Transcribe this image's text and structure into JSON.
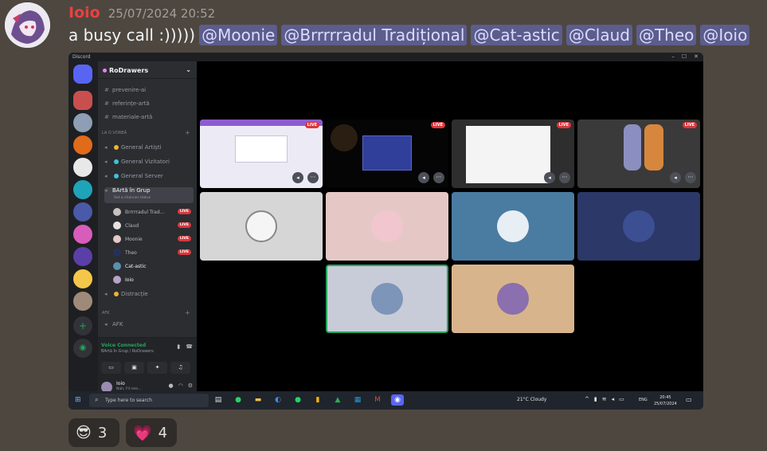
{
  "message": {
    "author": "Ioio",
    "timestamp": "25/07/2024 20:52",
    "text": "a busy call :)))))",
    "mentions": [
      "@Moonie",
      "@Brrrrradul Tradițional",
      "@Cat-astic",
      "@Claud",
      "@Theo",
      "@Ioio"
    ],
    "author_color": "#e8423f"
  },
  "screenshot": {
    "titlebar": {
      "app": "Discord",
      "min": "–",
      "max": "☐",
      "close": "✕"
    },
    "guild_name": "RoDrawers",
    "channels": [
      {
        "sym": "#",
        "label": "prevenire-ai"
      },
      {
        "sym": "#",
        "label": "referințe-artă"
      },
      {
        "sym": "#",
        "label": "materiale-artă"
      }
    ],
    "category_voice": "LA O VORBĂ",
    "voice_channels": [
      {
        "label": "General Artiști",
        "color": "#f0b232"
      },
      {
        "label": "General Vizitatori",
        "color": "#3ec4d8"
      },
      {
        "label": "General Server",
        "color": "#3ec4d8"
      }
    ],
    "active_channel": {
      "label": "BArtă în Grup",
      "status": "Set a channel status"
    },
    "voice_users": [
      {
        "name": "Brrrrradul Trad...",
        "live": "LIVE",
        "color": "#c9c0c0"
      },
      {
        "name": "Claud",
        "live": "LIVE",
        "color": "#e7e2e2"
      },
      {
        "name": "Moonie",
        "live": "LIVE",
        "color": "#e5c8c8"
      },
      {
        "name": "Theo",
        "live": "LIVE",
        "color": "#28305a"
      },
      {
        "name": "Cat-astic",
        "live": "",
        "color": "#5a8fae"
      },
      {
        "name": "Ioio",
        "live": "",
        "color": "#b7a2c9"
      }
    ],
    "other_channel": {
      "label": "Distracție",
      "color": "#f0b232"
    },
    "category_afk": "AFK",
    "afk_channel": "AFK",
    "voice_panel": {
      "status": "Voice Connected",
      "location": "BArtă în Grup / RoDrawers"
    },
    "user_panel": {
      "name": "Ioio",
      "sub": "Nah, I'll rem..."
    },
    "stream_badge": "LIVE",
    "taskbar": {
      "search_placeholder": "Type here to search",
      "weather": "21°C  Cloudy",
      "lang": "ENG",
      "time": "20:45",
      "date": "25/07/2024"
    }
  },
  "reactions": [
    {
      "emoji": "😎",
      "count": "3"
    },
    {
      "emoji": "💗",
      "count": "4"
    }
  ]
}
